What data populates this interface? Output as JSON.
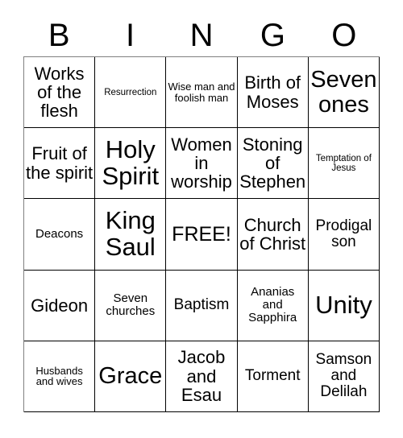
{
  "card": {
    "title": "BINGO",
    "header_letters": [
      "B",
      "I",
      "N",
      "G",
      "O"
    ],
    "free_space_label": "FREE!",
    "colors": {
      "text": "#000000",
      "grid_line": "#000000",
      "background": "#ffffff"
    },
    "grid": {
      "columns": 5,
      "rows": 5,
      "cells": [
        [
          {
            "text": "Works of the flesh",
            "size": "md"
          },
          {
            "text": "Resurrection",
            "size": "tiny"
          },
          {
            "text": "Wise man and foolish man",
            "size": "xxs"
          },
          {
            "text": "Birth of Moses",
            "size": "md"
          },
          {
            "text": "Seven ones",
            "size": "xl"
          }
        ],
        [
          {
            "text": "Fruit of the spirit",
            "size": "md"
          },
          {
            "text": "Holy Spirit",
            "size": "xxl"
          },
          {
            "text": "Women in worship",
            "size": "md"
          },
          {
            "text": "Stoning of Stephen",
            "size": "md"
          },
          {
            "text": "Temptation of Jesus",
            "size": "tiny"
          }
        ],
        [
          {
            "text": "Deacons",
            "size": "xs"
          },
          {
            "text": "King Saul",
            "size": "xxl"
          },
          {
            "text": "FREE!",
            "size": "lg"
          },
          {
            "text": "Church of Christ",
            "size": "md"
          },
          {
            "text": "Prodigal son",
            "size": "sm"
          }
        ],
        [
          {
            "text": "Gideon",
            "size": "md"
          },
          {
            "text": "Seven churches",
            "size": "xs"
          },
          {
            "text": "Baptism",
            "size": "sm"
          },
          {
            "text": "Ananias and Sapphira",
            "size": "xs"
          },
          {
            "text": "Unity",
            "size": "xxl"
          }
        ],
        [
          {
            "text": "Husbands and wives",
            "size": "xxs"
          },
          {
            "text": "Grace",
            "size": "xl"
          },
          {
            "text": "Jacob and Esau",
            "size": "md"
          },
          {
            "text": "Torment",
            "size": "sm"
          },
          {
            "text": "Samson and Delilah",
            "size": "sm"
          }
        ]
      ]
    }
  }
}
